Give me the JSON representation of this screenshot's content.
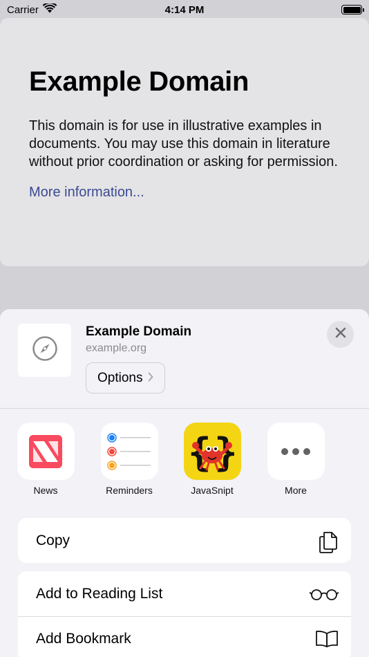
{
  "status_bar": {
    "carrier": "Carrier",
    "time": "4:14 PM"
  },
  "web_page": {
    "title": "Example Domain",
    "body": "This domain is for use in illustrative examples in documents. You may use this domain in literature without prior coordination or asking for permission.",
    "link": "More information..."
  },
  "share_sheet": {
    "title": "Example Domain",
    "subtitle": "example.org",
    "options_label": "Options",
    "apps": [
      {
        "label": "News",
        "icon": "news-icon"
      },
      {
        "label": "Reminders",
        "icon": "reminders-icon"
      },
      {
        "label": "JavaSnipt",
        "icon": "javasnipt-icon"
      },
      {
        "label": "More",
        "icon": "more-icon"
      }
    ],
    "actions": [
      {
        "label": "Copy",
        "icon": "copy-icon"
      },
      {
        "label": "Add to Reading List",
        "icon": "glasses-icon"
      },
      {
        "label": "Add Bookmark",
        "icon": "book-icon"
      }
    ]
  },
  "colors": {
    "link": "#3b4a92",
    "news_red": "#f94a5f",
    "reminders_blue": "#1a82f8",
    "reminders_red": "#f44a3d",
    "reminders_orange": "#f8a21c",
    "javasnipt_yellow": "#f3d514"
  }
}
